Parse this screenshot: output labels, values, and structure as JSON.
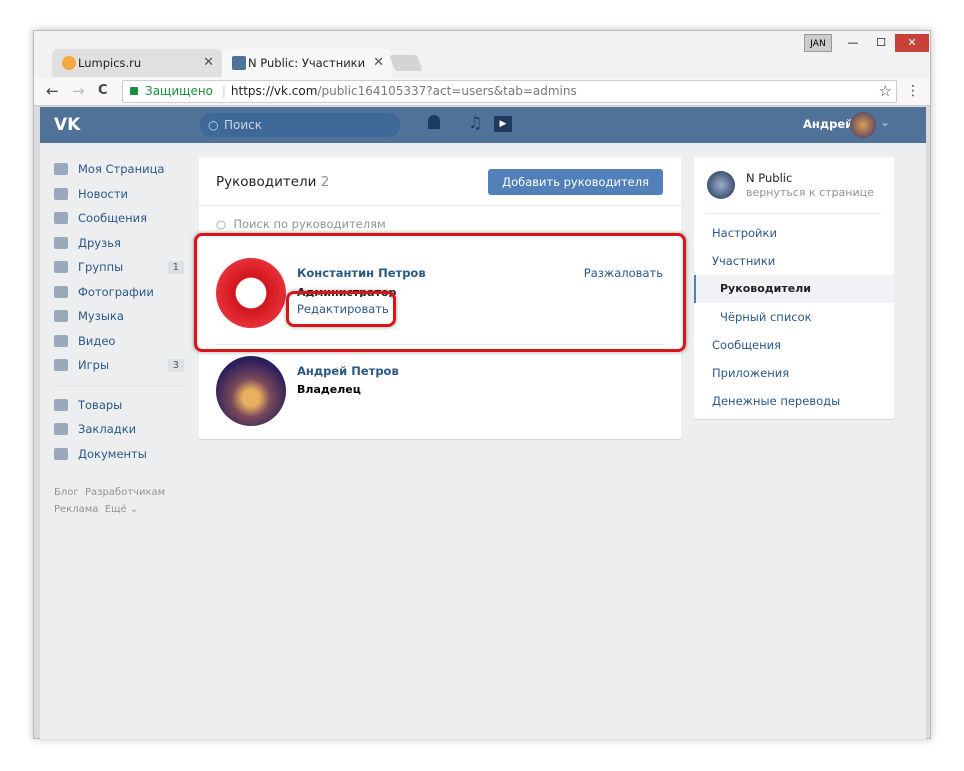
{
  "browser": {
    "tabs": [
      {
        "title": "Lumpics.ru",
        "close": "✕"
      },
      {
        "title": "N Public: Участники",
        "close": "✕"
      }
    ],
    "user_badge": "JAN",
    "minimize": "—",
    "maximize": "☐",
    "close": "✕",
    "secure_label": "Защищено",
    "url_host": "https://vk.com",
    "url_path": "/public164105337?act=users&tab=admins",
    "back": "←",
    "forward": "→",
    "reload": "C",
    "star": "☆",
    "menu": "⋮"
  },
  "header": {
    "logo": "VK",
    "search_placeholder": "Поиск",
    "user_name": "Андрей",
    "chevron": "⌄"
  },
  "sidebar": {
    "items": [
      {
        "label": "Моя Страница"
      },
      {
        "label": "Новости"
      },
      {
        "label": "Сообщения"
      },
      {
        "label": "Друзья"
      },
      {
        "label": "Группы",
        "badge": "1"
      },
      {
        "label": "Фотографии"
      },
      {
        "label": "Музыка"
      },
      {
        "label": "Видео"
      },
      {
        "label": "Игры",
        "badge": "3"
      }
    ],
    "items2": [
      {
        "label": "Товары"
      },
      {
        "label": "Закладки"
      },
      {
        "label": "Документы"
      }
    ],
    "footer": [
      "Блог",
      "Разработчикам",
      "Реклама",
      "Ещё ⌄"
    ]
  },
  "main": {
    "title": "Руководители",
    "count": "2",
    "add_button": "Добавить руководителя",
    "search_placeholder": "Поиск по руководителям",
    "managers": [
      {
        "name": "Константин Петров",
        "role": "Администратор",
        "demote": "Разжаловать",
        "edit": "Редактировать"
      },
      {
        "name": "Андрей Петров",
        "role": "Владелец"
      }
    ]
  },
  "right": {
    "group_name": "N Public",
    "back_link": "вернуться к странице",
    "menu": [
      "Настройки",
      "Участники",
      "Руководители",
      "Чёрный список",
      "Сообщения",
      "Приложения",
      "Денежные переводы"
    ],
    "active": "Руководители"
  },
  "colors": {
    "vk_blue": "#507299",
    "link": "#2a5885",
    "highlight": "#d9141a"
  }
}
